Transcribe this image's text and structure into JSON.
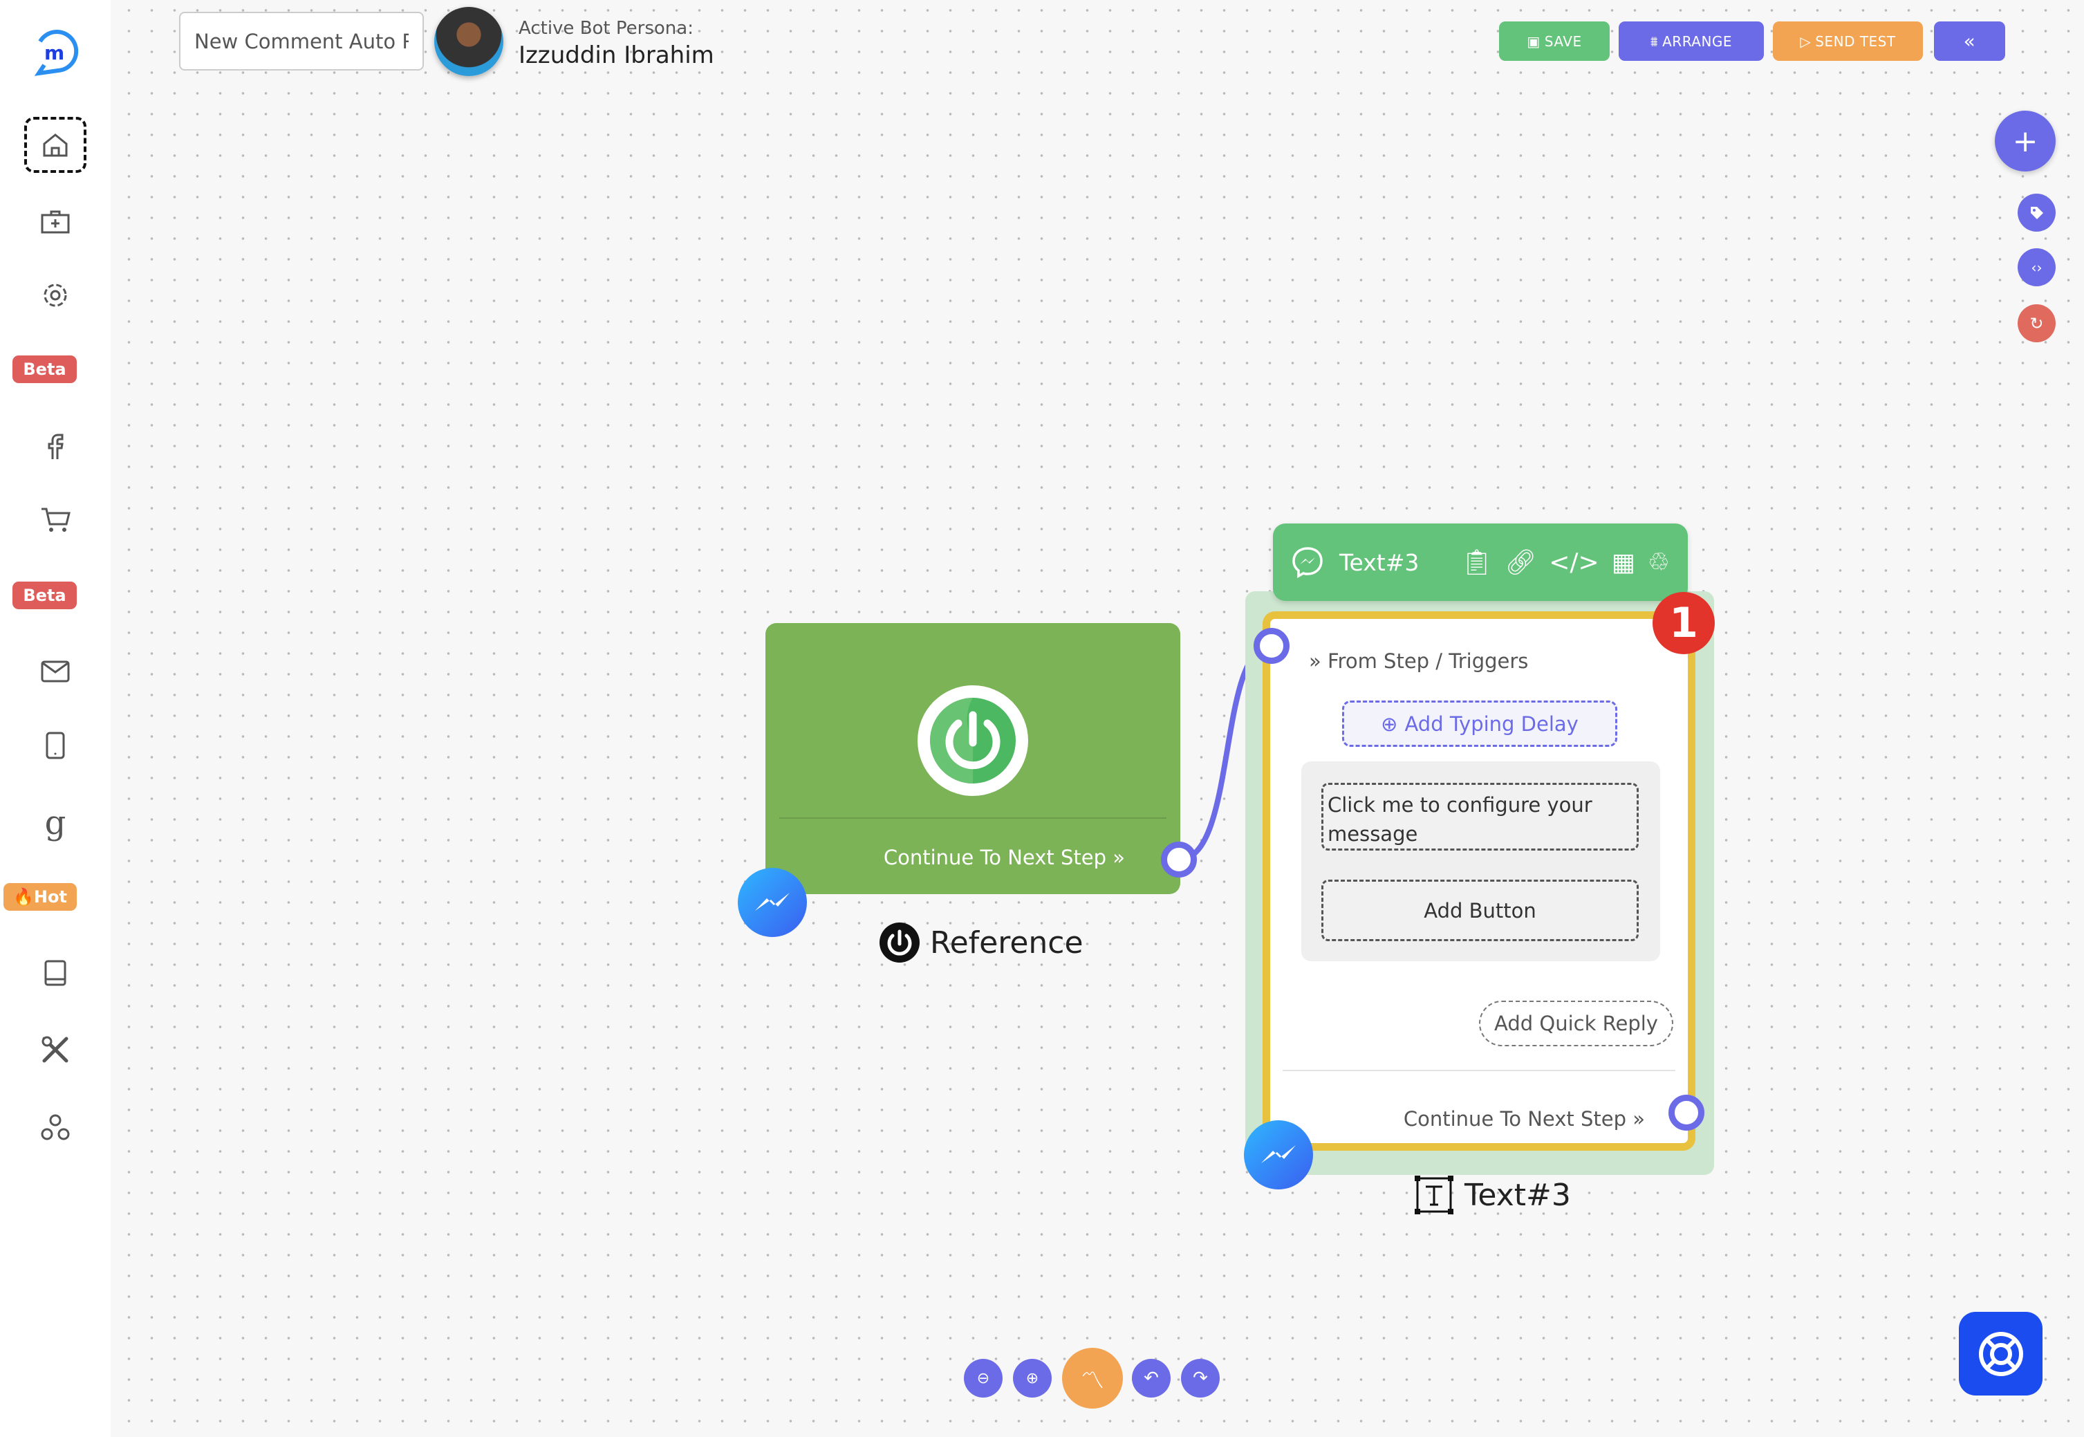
{
  "header": {
    "flow_name": "New Comment Auto R",
    "persona_label": "Active Bot Persona:",
    "persona_name": "Izzuddin Ibrahim",
    "buttons": {
      "save": "SAVE",
      "arrange": "ARRANGE",
      "send_test": "SEND TEST",
      "collapse": "«"
    }
  },
  "sidebar": {
    "items": [
      {
        "icon": "home-icon"
      },
      {
        "icon": "briefcase-plus-icon"
      },
      {
        "icon": "gear-icon"
      },
      {
        "badge": "Beta"
      },
      {
        "icon": "facebook-icon"
      },
      {
        "icon": "cart-icon"
      },
      {
        "badge": "Beta"
      },
      {
        "icon": "mail-icon"
      },
      {
        "icon": "tablet-icon"
      },
      {
        "icon": "google-icon"
      },
      {
        "badge": "Hot"
      },
      {
        "icon": "book-icon"
      },
      {
        "icon": "tools-icon"
      },
      {
        "icon": "apps-icon"
      }
    ]
  },
  "start_node": {
    "continue_label": "Continue To Next Step",
    "caption": "Reference"
  },
  "text_node": {
    "title": "Text#3",
    "badge": "1",
    "from_label": "From Step / Triggers",
    "typing_delay": "Add Typing Delay",
    "message_placeholder": "Click me to configure your message",
    "add_button": "Add Button",
    "quick_reply": "Add Quick Reply",
    "continue_label": "Continue To Next Step",
    "caption": "Text#3"
  },
  "colors": {
    "green": "#63c37a",
    "node_green": "#7cb356",
    "purple": "#6c6be7",
    "orange": "#f2a452",
    "red": "#e06a5e",
    "yellow": "#e8c23f",
    "help_blue": "#1a4cf0"
  }
}
